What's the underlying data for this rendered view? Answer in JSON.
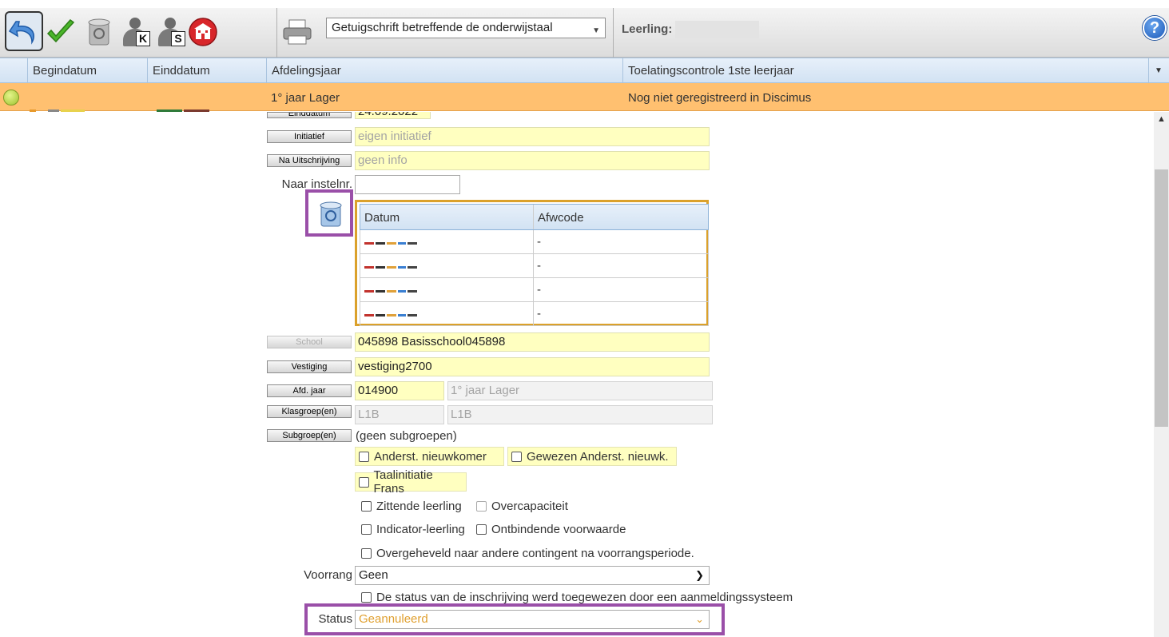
{
  "toolbar": {
    "icons": [
      "undo-icon",
      "check-icon",
      "recycle-bin-icon",
      "person-k-icon",
      "person-s-icon",
      "school-icon",
      "printer-icon"
    ],
    "person_k_letter": "K",
    "person_s_letter": "S",
    "report_select": "Getuigschrift betreffende de onderwijstaal",
    "student_label": "Leerling:",
    "help_label": "?"
  },
  "grid": {
    "columns": [
      "Begindatum",
      "Einddatum",
      "Afdelingsjaar",
      "Toelatingscontrole 1ste leerjaar"
    ],
    "row": {
      "afdelingsjaar": "1° jaar Lager",
      "toelatingscontrole": "Nog niet geregistreerd in Discimus"
    },
    "row_color": "#ffc070"
  },
  "form": {
    "einddatum_label": "Einddatum",
    "einddatum_value": "24.09.2022",
    "initiatief_label": "Initiatief",
    "initiatief_value": "eigen initiatief",
    "na_uitschrijving_label": "Na Uitschrijving",
    "na_uitschrijving_value": "geen info",
    "naar_instelnr_label": "Naar instelnr.",
    "absence_table": {
      "headers": [
        "Datum",
        "Afwcode"
      ],
      "rows": [
        {
          "afwcode": "-"
        },
        {
          "afwcode": "-"
        },
        {
          "afwcode": "-"
        },
        {
          "afwcode": "-"
        }
      ]
    },
    "school_label": "School",
    "school_value": "045898 Basisschool045898",
    "vestiging_label": "Vestiging",
    "vestiging_value": "vestiging2700",
    "afd_jaar_label": "Afd. jaar",
    "afd_jaar_code": "014900",
    "afd_jaar_name": "1° jaar Lager",
    "klasgroep_label": "Klasgroep(en)",
    "klasgroep_value1": "L1B",
    "klasgroep_value2": "L1B",
    "subgroep_label": "Subgroep(en)",
    "subgroep_value": "(geen subgroepen)",
    "checkboxes": {
      "anderst_nieuwkomer": "Anderst. nieuwkomer",
      "gewezen_anderst": "Gewezen Anderst. nieuwk.",
      "taalinitiatie_frans": "Taalinitiatie Frans",
      "zittende_leerling": "Zittende leerling",
      "overcapaciteit": "Overcapaciteit",
      "indicator_leerling": "Indicator-leerling",
      "ontbindende_voorwaarde": "Ontbindende voorwaarde",
      "overgeheveld": "Overgeheveld naar andere contingent na voorrangsperiode.",
      "status_aanmeldingssysteem": "De status van de inschrijving werd toegewezen door een aanmeldingssysteem"
    },
    "voorrang_label": "Voorrang",
    "voorrang_value": "Geen",
    "status_label": "Status",
    "status_value": "Geannuleerd",
    "status_color": "#e0a030"
  }
}
